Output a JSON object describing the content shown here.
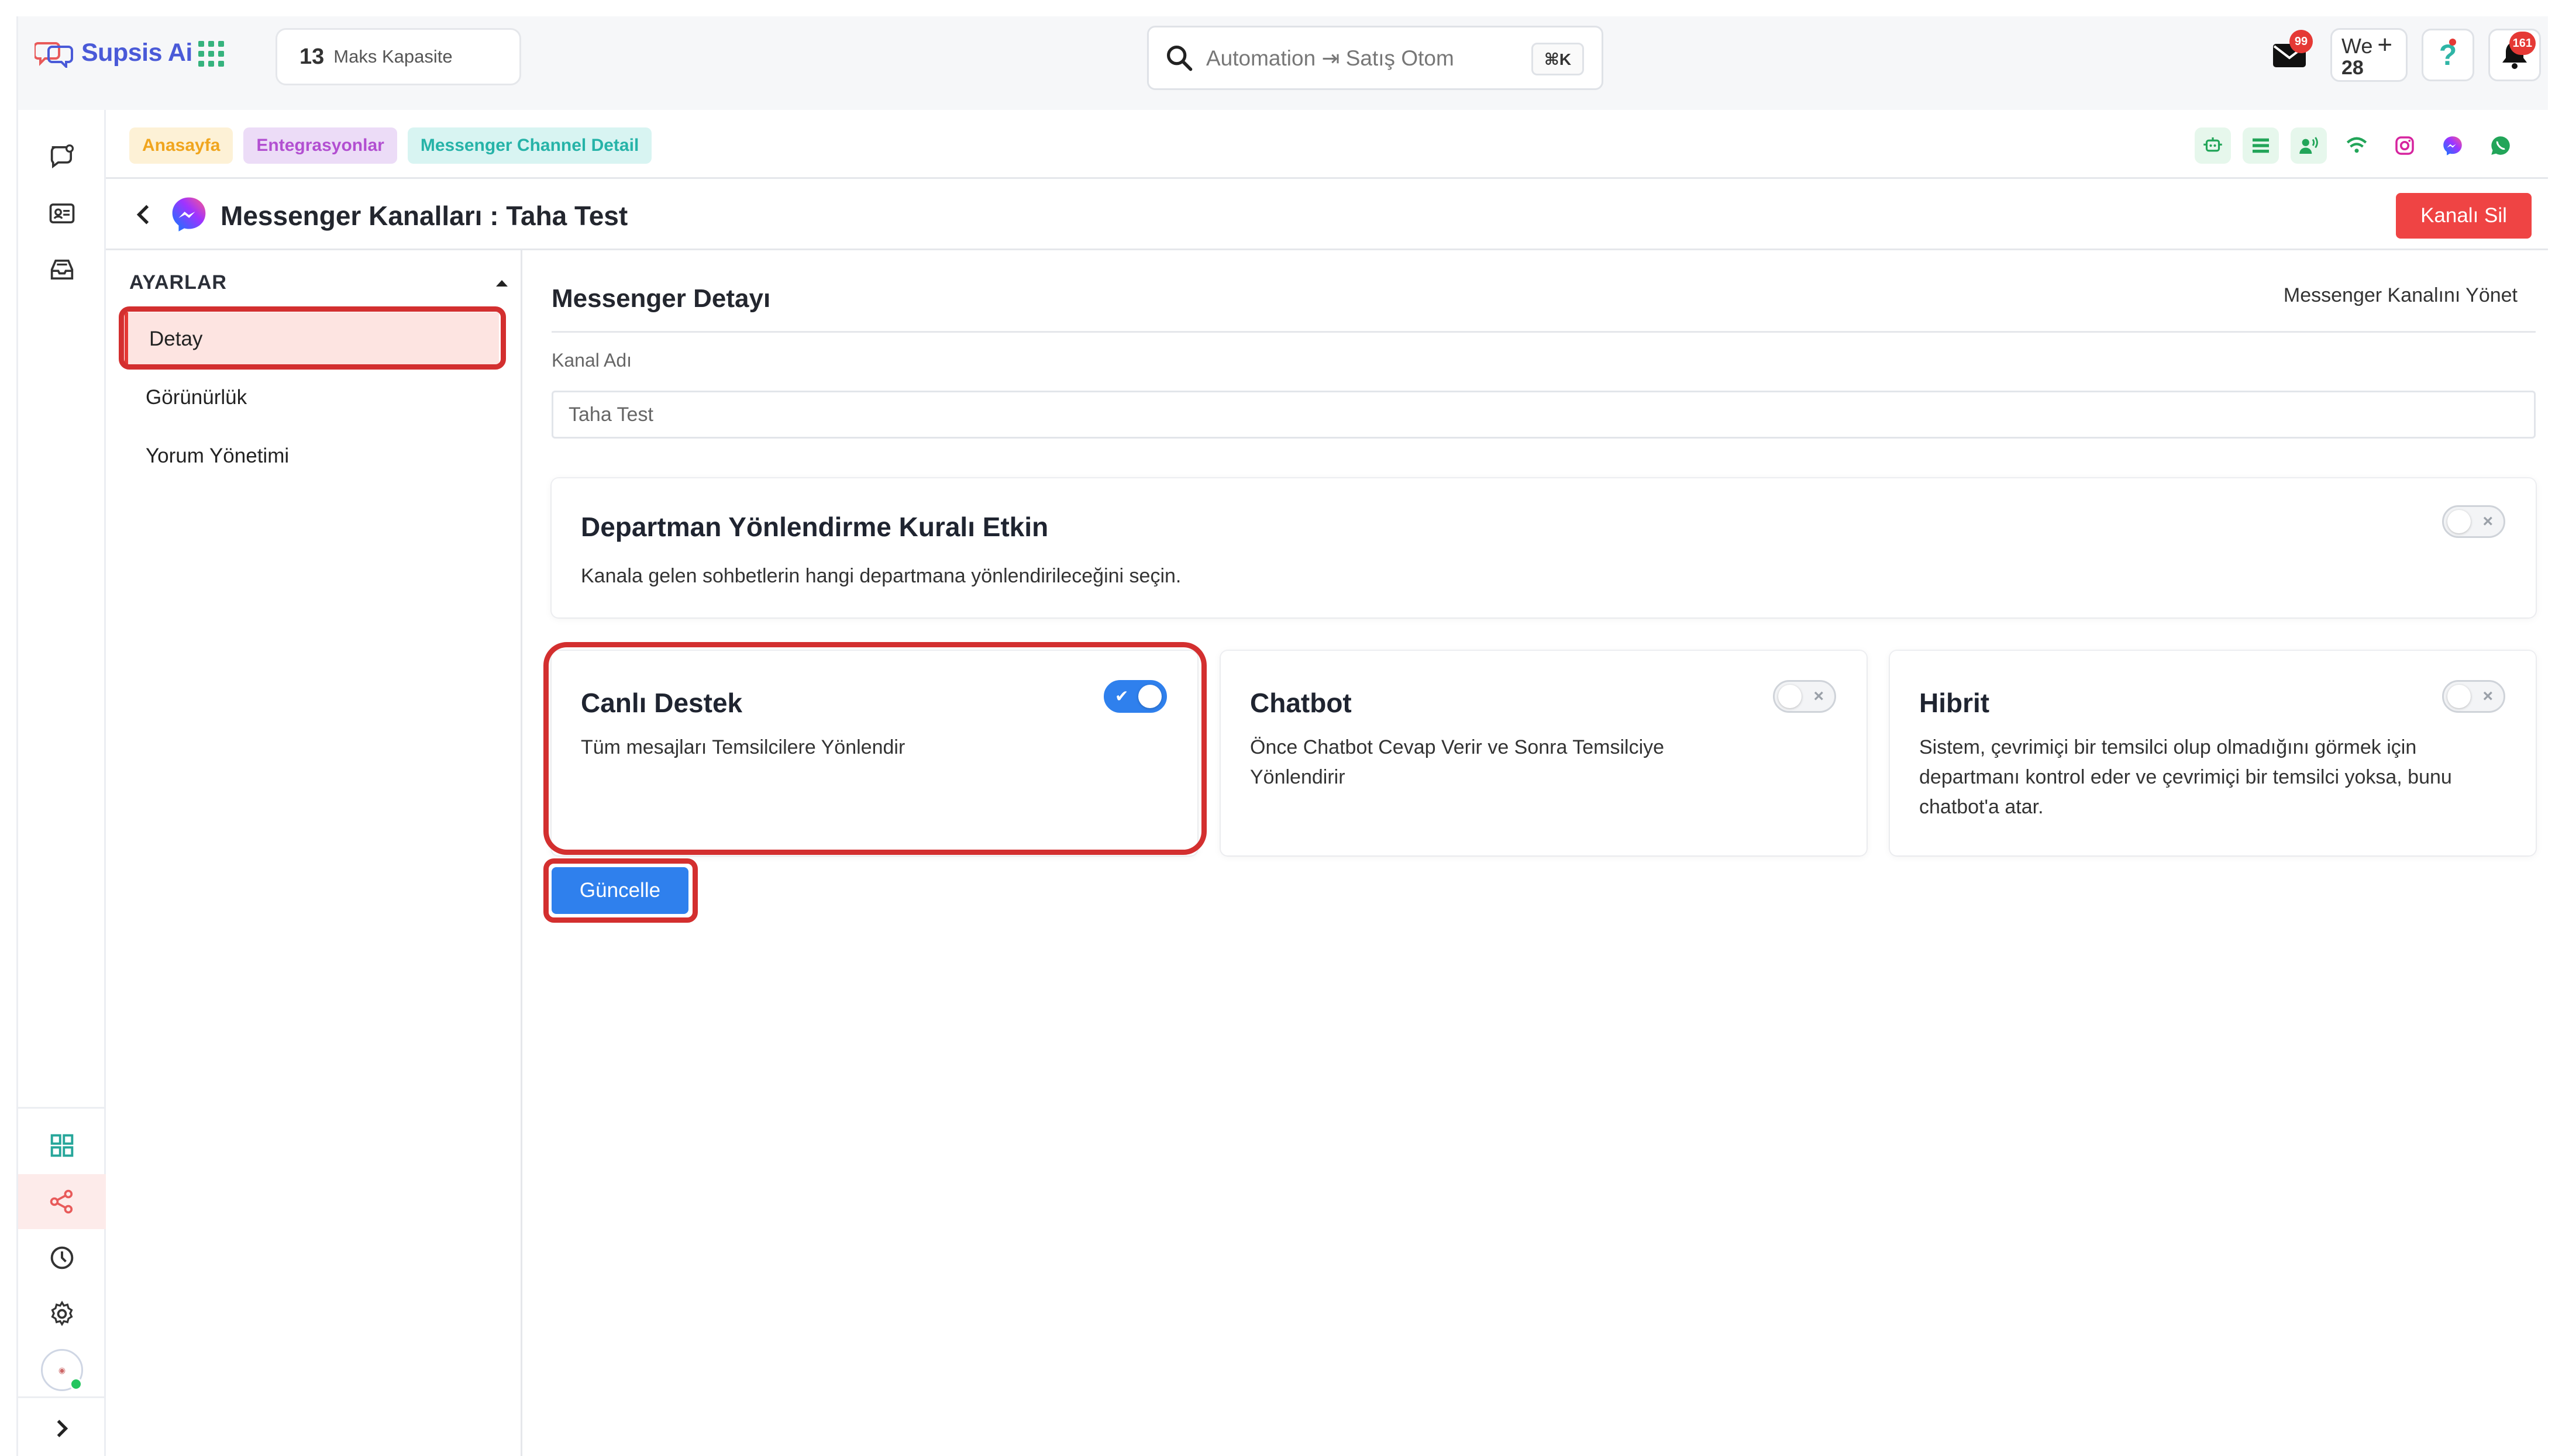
{
  "app": {
    "logo_text": "Supsis Ai",
    "capacity_number": "13",
    "capacity_label": "Maks Kapasite",
    "search_value": "Automation ⇥ Satış Otom",
    "search_shortcut": "⌘K",
    "mail_badge": "99",
    "we_label": "We",
    "we_count": "28",
    "notif_badge": "161"
  },
  "breadcrumbs": [
    "Anasayfa",
    "Entegrasyonlar",
    "Messenger Channel Detail"
  ],
  "channel_icons": [
    "chatbot-icon",
    "list-icon",
    "voice-icon",
    "wifi-icon",
    "instagram-icon",
    "messenger-icon",
    "whatsapp-icon"
  ],
  "header": {
    "title": "Messenger Kanalları : Taha Test",
    "delete_label": "Kanalı Sil"
  },
  "settings": {
    "heading": "AYARLAR",
    "items": [
      "Detay",
      "Görünürlük",
      "Yorum Yönetimi"
    ],
    "active_index": 0
  },
  "detail": {
    "section_title": "Messenger Detayı",
    "manage_link": "Messenger Kanalını Yönet",
    "channel_name_label": "Kanal Adı",
    "channel_name_value": "Taha Test",
    "department_rule": {
      "title": "Departman Yönlendirme Kuralı Etkin",
      "description": "Kanala gelen sohbetlerin hangi departmana yönlendirileceğini seçin.",
      "enabled": false
    },
    "modes": [
      {
        "title": "Canlı Destek",
        "description": "Tüm mesajları Temsilcilere Yönlendir",
        "enabled": true
      },
      {
        "title": "Chatbot",
        "description": "Önce Chatbot Cevap Verir ve Sonra Temsilciye Yönlendirir",
        "enabled": false
      },
      {
        "title": "Hibrit",
        "description": "Sistem, çevrimiçi bir temsilci olup olmadığını görmek için departmanı kontrol eder ve çevrimiçi bir temsilci yoksa, bunu chatbot'a atar.",
        "enabled": false
      }
    ],
    "update_label": "Güncelle"
  },
  "colors": {
    "brand": "#4a5ad8",
    "highlight": "#d32f2f",
    "primary": "#2f80ed",
    "danger": "#ef4444"
  }
}
